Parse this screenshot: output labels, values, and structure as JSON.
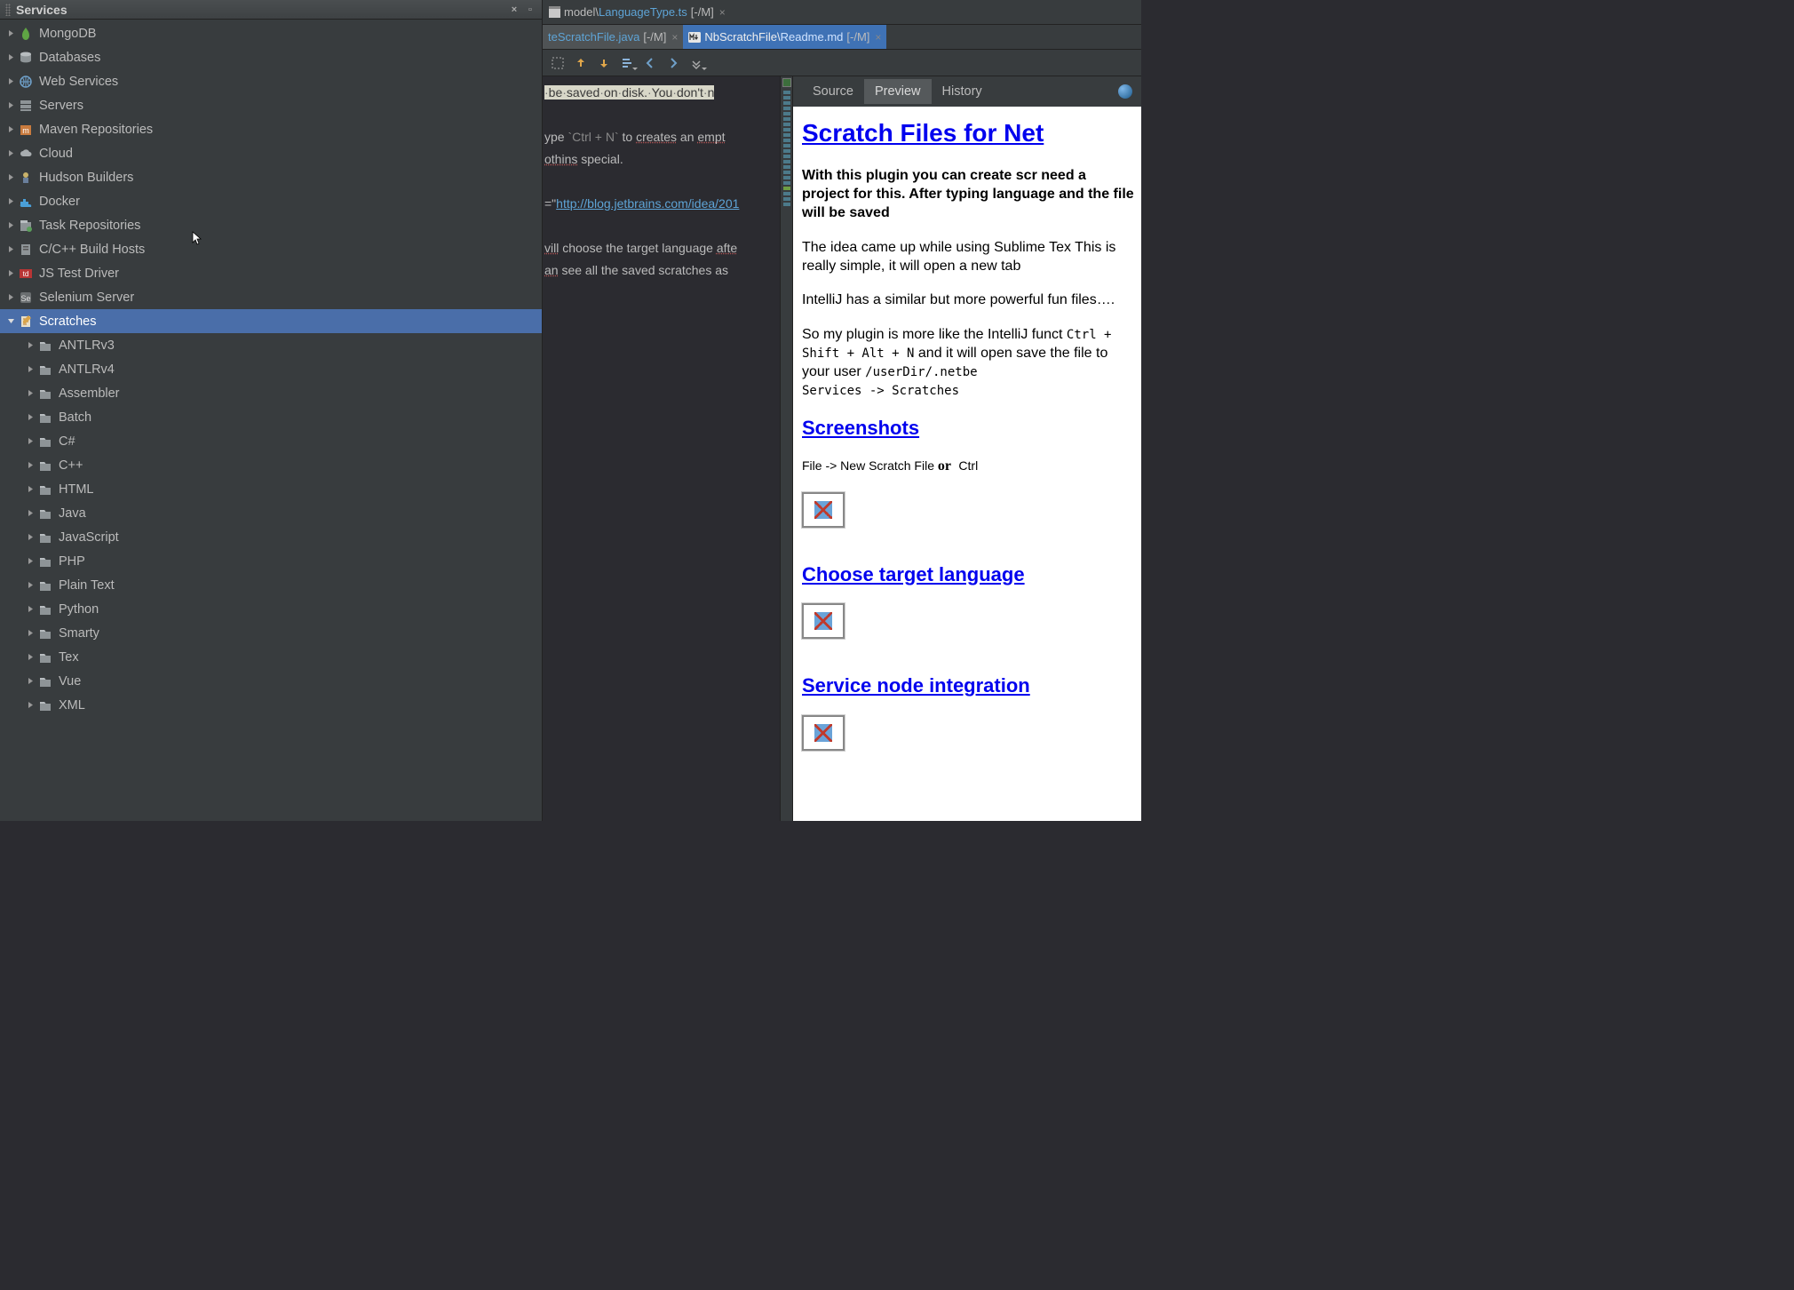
{
  "sidebar": {
    "title": "Services",
    "nodes": [
      {
        "label": "MongoDB",
        "icon": "mongodb",
        "expanded": false,
        "depth": 0
      },
      {
        "label": "Databases",
        "icon": "database",
        "expanded": false,
        "depth": 0
      },
      {
        "label": "Web Services",
        "icon": "webservice",
        "expanded": false,
        "depth": 0
      },
      {
        "label": "Servers",
        "icon": "servers",
        "expanded": false,
        "depth": 0
      },
      {
        "label": "Maven Repositories",
        "icon": "maven",
        "expanded": false,
        "depth": 0
      },
      {
        "label": "Cloud",
        "icon": "cloud",
        "expanded": false,
        "depth": 0
      },
      {
        "label": "Hudson Builders",
        "icon": "hudson",
        "expanded": false,
        "depth": 0
      },
      {
        "label": "Docker",
        "icon": "docker",
        "expanded": false,
        "depth": 0
      },
      {
        "label": "Task Repositories",
        "icon": "taskrepo",
        "expanded": false,
        "depth": 0
      },
      {
        "label": "C/C++ Build Hosts",
        "icon": "buildhost",
        "expanded": false,
        "depth": 0
      },
      {
        "label": "JS Test Driver",
        "icon": "jstest",
        "expanded": false,
        "depth": 0
      },
      {
        "label": "Selenium Server",
        "icon": "selenium",
        "expanded": false,
        "depth": 0
      },
      {
        "label": "Scratches",
        "icon": "scratches",
        "expanded": true,
        "depth": 0,
        "selected": true
      },
      {
        "label": "ANTLRv3",
        "icon": "folder",
        "expanded": false,
        "depth": 1
      },
      {
        "label": "ANTLRv4",
        "icon": "folder",
        "expanded": false,
        "depth": 1
      },
      {
        "label": "Assembler",
        "icon": "folder",
        "expanded": false,
        "depth": 1
      },
      {
        "label": "Batch",
        "icon": "folder",
        "expanded": false,
        "depth": 1
      },
      {
        "label": "C#",
        "icon": "folder",
        "expanded": false,
        "depth": 1
      },
      {
        "label": "C++",
        "icon": "folder",
        "expanded": false,
        "depth": 1
      },
      {
        "label": "HTML",
        "icon": "folder",
        "expanded": false,
        "depth": 1
      },
      {
        "label": "Java",
        "icon": "folder",
        "expanded": false,
        "depth": 1
      },
      {
        "label": "JavaScript",
        "icon": "folder",
        "expanded": false,
        "depth": 1
      },
      {
        "label": "PHP",
        "icon": "folder",
        "expanded": false,
        "depth": 1
      },
      {
        "label": "Plain Text",
        "icon": "folder",
        "expanded": false,
        "depth": 1
      },
      {
        "label": "Python",
        "icon": "folder",
        "expanded": false,
        "depth": 1
      },
      {
        "label": "Smarty",
        "icon": "folder",
        "expanded": false,
        "depth": 1
      },
      {
        "label": "Tex",
        "icon": "folder",
        "expanded": false,
        "depth": 1
      },
      {
        "label": "Vue",
        "icon": "folder",
        "expanded": false,
        "depth": 1
      },
      {
        "label": "XML",
        "icon": "folder",
        "expanded": false,
        "depth": 1
      }
    ]
  },
  "tabs_top": [
    {
      "prefix": "model\\",
      "hl": "LanguageType.ts",
      "suffix": "[-/M]",
      "active": false,
      "icon": "ts"
    }
  ],
  "tabs_second": [
    {
      "prefix": "",
      "hl": "teScratchFile.java",
      "suffix": "[-/M]",
      "active": true,
      "icon": ""
    },
    {
      "prefix": "NbScratchFile\\",
      "hl": "Readme.md",
      "suffix": "[-/M]",
      "active": "active-md",
      "icon": "md"
    }
  ],
  "toolbar": [
    {
      "name": "selection-icon",
      "dd": false
    },
    {
      "name": "shift-up-icon",
      "dd": false
    },
    {
      "name": "shift-down-icon",
      "dd": false
    },
    {
      "name": "outdent-icon",
      "dd": true
    },
    {
      "name": "back-icon",
      "dd": false
    },
    {
      "name": "forward-icon",
      "dd": false
    },
    {
      "name": "more-icon",
      "dd": true
    }
  ],
  "code_lines": [
    {
      "type": "hl",
      "text": "·be·saved·on·disk.·You·don't·n"
    },
    {
      "type": "blank",
      "text": ""
    },
    {
      "type": "norm",
      "parts": [
        {
          "t": "ype "
        },
        {
          "t": "`Ctrl + N`",
          "cls": "kw"
        },
        {
          "t": " to "
        },
        {
          "t": "creates",
          "cls": "sp"
        },
        {
          "t": " an "
        },
        {
          "t": "empt",
          "cls": "sp"
        }
      ]
    },
    {
      "type": "norm",
      "parts": [
        {
          "t": "othins",
          "cls": "sp"
        },
        {
          "t": " special."
        }
      ]
    },
    {
      "type": "blank",
      "text": ""
    },
    {
      "type": "norm",
      "parts": [
        {
          "t": "=\""
        },
        {
          "t": "http://blog.jetbrains.com/idea/201",
          "cls": "lnk"
        }
      ]
    },
    {
      "type": "blank",
      "text": ""
    },
    {
      "type": "norm",
      "parts": [
        {
          "t": "vill",
          "cls": "sp"
        },
        {
          "t": " choose the target language "
        },
        {
          "t": "afte",
          "cls": "sp"
        }
      ]
    },
    {
      "type": "norm",
      "parts": [
        {
          "t": "an",
          "cls": "sp"
        },
        {
          "t": " see all the saved scratches as"
        }
      ]
    }
  ],
  "error_stripe": [
    {
      "color": "#4C7A8A"
    },
    {
      "color": "#4C7A8A"
    },
    {
      "color": "#4C7A8A"
    },
    {
      "color": "#4C7A8A"
    },
    {
      "color": "#4C7A8A"
    },
    {
      "color": "#4C7A8A"
    },
    {
      "color": "#4C7A8A"
    },
    {
      "color": "#4C7A8A"
    },
    {
      "color": "#4C7A8A"
    },
    {
      "color": "#4C7A8A"
    },
    {
      "color": "#4C7A8A"
    },
    {
      "color": "#4C7A8A"
    },
    {
      "color": "#4C7A8A"
    },
    {
      "color": "#4C7A8A"
    },
    {
      "color": "#4C7A8A"
    },
    {
      "color": "#4C7A8A"
    },
    {
      "color": "#4C7A8A"
    },
    {
      "color": "#4C7A8A"
    },
    {
      "color": "#6E9E44"
    },
    {
      "color": "#4C7A8A"
    },
    {
      "color": "#4C7A8A"
    },
    {
      "color": "#4C7A8A"
    }
  ],
  "preview_tabs": {
    "source": "Source",
    "preview": "Preview",
    "history": "History",
    "active": "preview"
  },
  "doc": {
    "h1": "Scratch Files for Net",
    "bold_intro": "With this plugin you can create scr need a project for this. After typing language and the file will be saved",
    "p1": "The idea came up while using Sublime Tex This is really simple, it will open a new tab",
    "p2": "IntelliJ has a similar but more powerful fun files….",
    "p3_a": "So my plugin is more like the IntelliJ funct ",
    "p3_code1": "Ctrl + Shift + Alt + N",
    "p3_b": " and it will open save the file to your user ",
    "p3_code2": "/userDir/.netbe",
    "p3_code3": "Services -> Scratches",
    "h2_screens": "Screenshots",
    "screens_line_a": "File -> New Scratch File ",
    "screens_or": "or",
    "screens_line_b": " Ctrl",
    "h2_lang": "Choose target language",
    "h2_service": "Service node integration"
  }
}
